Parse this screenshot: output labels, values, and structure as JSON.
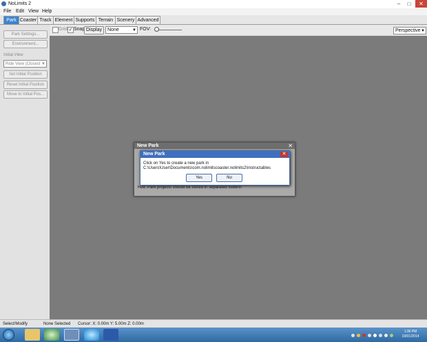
{
  "window": {
    "title": "NoLimits 2"
  },
  "menu": [
    "File",
    "Edit",
    "View",
    "Help"
  ],
  "tabs": [
    {
      "label": "Park",
      "active": true
    },
    {
      "label": "Coaster",
      "active": false
    },
    {
      "label": "Track",
      "active": false
    },
    {
      "label": "Element",
      "active": false
    },
    {
      "label": "Supports",
      "active": false
    },
    {
      "label": "Terrain",
      "active": false
    },
    {
      "label": "Scenery",
      "active": false
    },
    {
      "label": "Advanced",
      "active": false
    }
  ],
  "toolbar": {
    "grid_label": "Grid",
    "snap_label": "Snap",
    "display_label": "Display",
    "none_select": "None",
    "fov_label": "FOV:",
    "perspective_select": "Perspective"
  },
  "left_panel": {
    "park_settings": "Park Settings...",
    "environment": "Environment...",
    "initial_view_label": "Initial View",
    "initial_view_select": "Ride View (Closest",
    "set_initial_position": "Set Initial Position",
    "reset_initial_position": "Reset Initial Position",
    "move_to_initial_pos": "Move to Initial Pos..."
  },
  "dialog_back": {
    "title": "New Park",
    "hint": "Hint: Park projects should be stored in separated folders!"
  },
  "dialog_front": {
    "title": "New Park",
    "line1": "Click on Yes to create a new park in",
    "line2": "C:\\Users\\User\\Documents\\com.nolimitscoaster.nolimits2\\Instructables",
    "yes": "Yes",
    "no": "No"
  },
  "status": {
    "mode": "Select/Modify",
    "selection": "None Selected",
    "cursor": "Cursor: X: 0.00m Y: 5.00m Z: 0.00m"
  },
  "taskbar": {
    "time": "1:36 PM",
    "date": "19/01/2014"
  },
  "colors": {
    "accent": "#3b84cf",
    "viewport": "#7b7b7b"
  }
}
